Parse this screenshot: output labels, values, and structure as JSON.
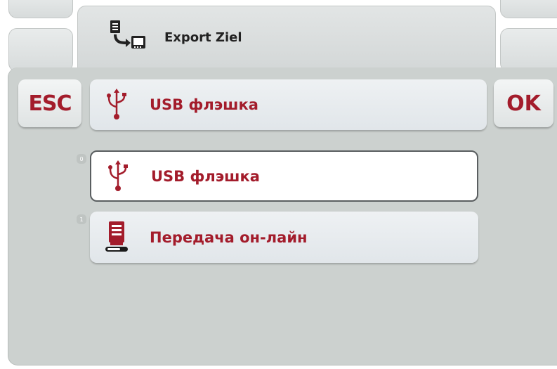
{
  "header": {
    "title": "Export Ziel"
  },
  "buttons": {
    "esc_label": "ESC",
    "ok_label": "OK"
  },
  "selection": {
    "value": "USB флэшка",
    "icon": "usb-icon"
  },
  "options": [
    {
      "index": "0",
      "label": "USB флэшка",
      "icon": "usb-icon",
      "selected": true
    },
    {
      "index": "1",
      "label": "Передача он-лайн",
      "icon": "online-transfer-icon",
      "selected": false
    }
  ],
  "colors": {
    "accent": "#a31c2b",
    "panel": "#ccd1cf"
  }
}
